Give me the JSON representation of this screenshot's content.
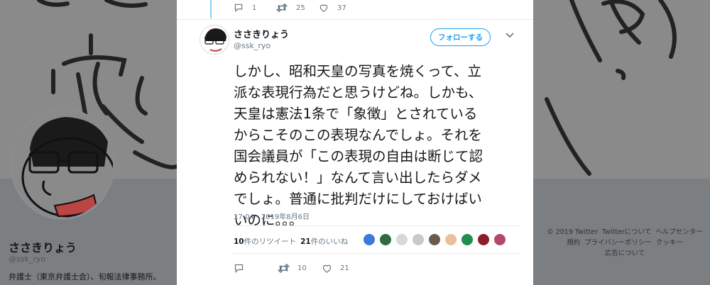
{
  "profile": {
    "name": "ささきりょう",
    "handle": "@ssk_ryo",
    "bio": "弁護士（東京弁護士会）、旬報法律事務所。"
  },
  "footer": {
    "items": [
      "© 2019 Twitter",
      "Twitterについて",
      "ヘルプセンター",
      "規約",
      "プライバシーポリシー",
      "クッキー",
      "広告について"
    ]
  },
  "previous_tweet": {
    "reply_count": "1",
    "retweet_count": "25",
    "like_count": "37"
  },
  "tweet": {
    "author_name": "ささきりょう",
    "author_handle": "@ssk_ryo",
    "follow_label": "フォローする",
    "lines": [
      "しかし、昭和天皇の写真を焼くって、立",
      "派な表現行為だと思うけどね。しかも、",
      "天皇は憲法1条で「象徴」とされている",
      "からこそのこの表現なんでしょ。それを",
      "国会議員が「この表現の自由は断じて認",
      "められない！」なんて言い出したらダメ",
      "でしょ。普通に批判だけにしておけばい",
      "いのに。。。"
    ],
    "timestamp": "17:04 - 2019年8月6日",
    "retweets_number": "10",
    "retweets_suffix": "件のリツイート",
    "likes_number": "21",
    "likes_suffix": "件のいいね",
    "liker_colors": [
      "#3a7bd5",
      "#2f6b3c",
      "#d8d8d8",
      "#c9c9c9",
      "#6d5a4b",
      "#e8c19a",
      "#1f8f4e",
      "#8a1f2b",
      "#b34a6a"
    ],
    "action_retweet_count": "10",
    "action_like_count": "21"
  },
  "colors": {
    "accent": "#1da1f2",
    "muted": "#657786"
  }
}
